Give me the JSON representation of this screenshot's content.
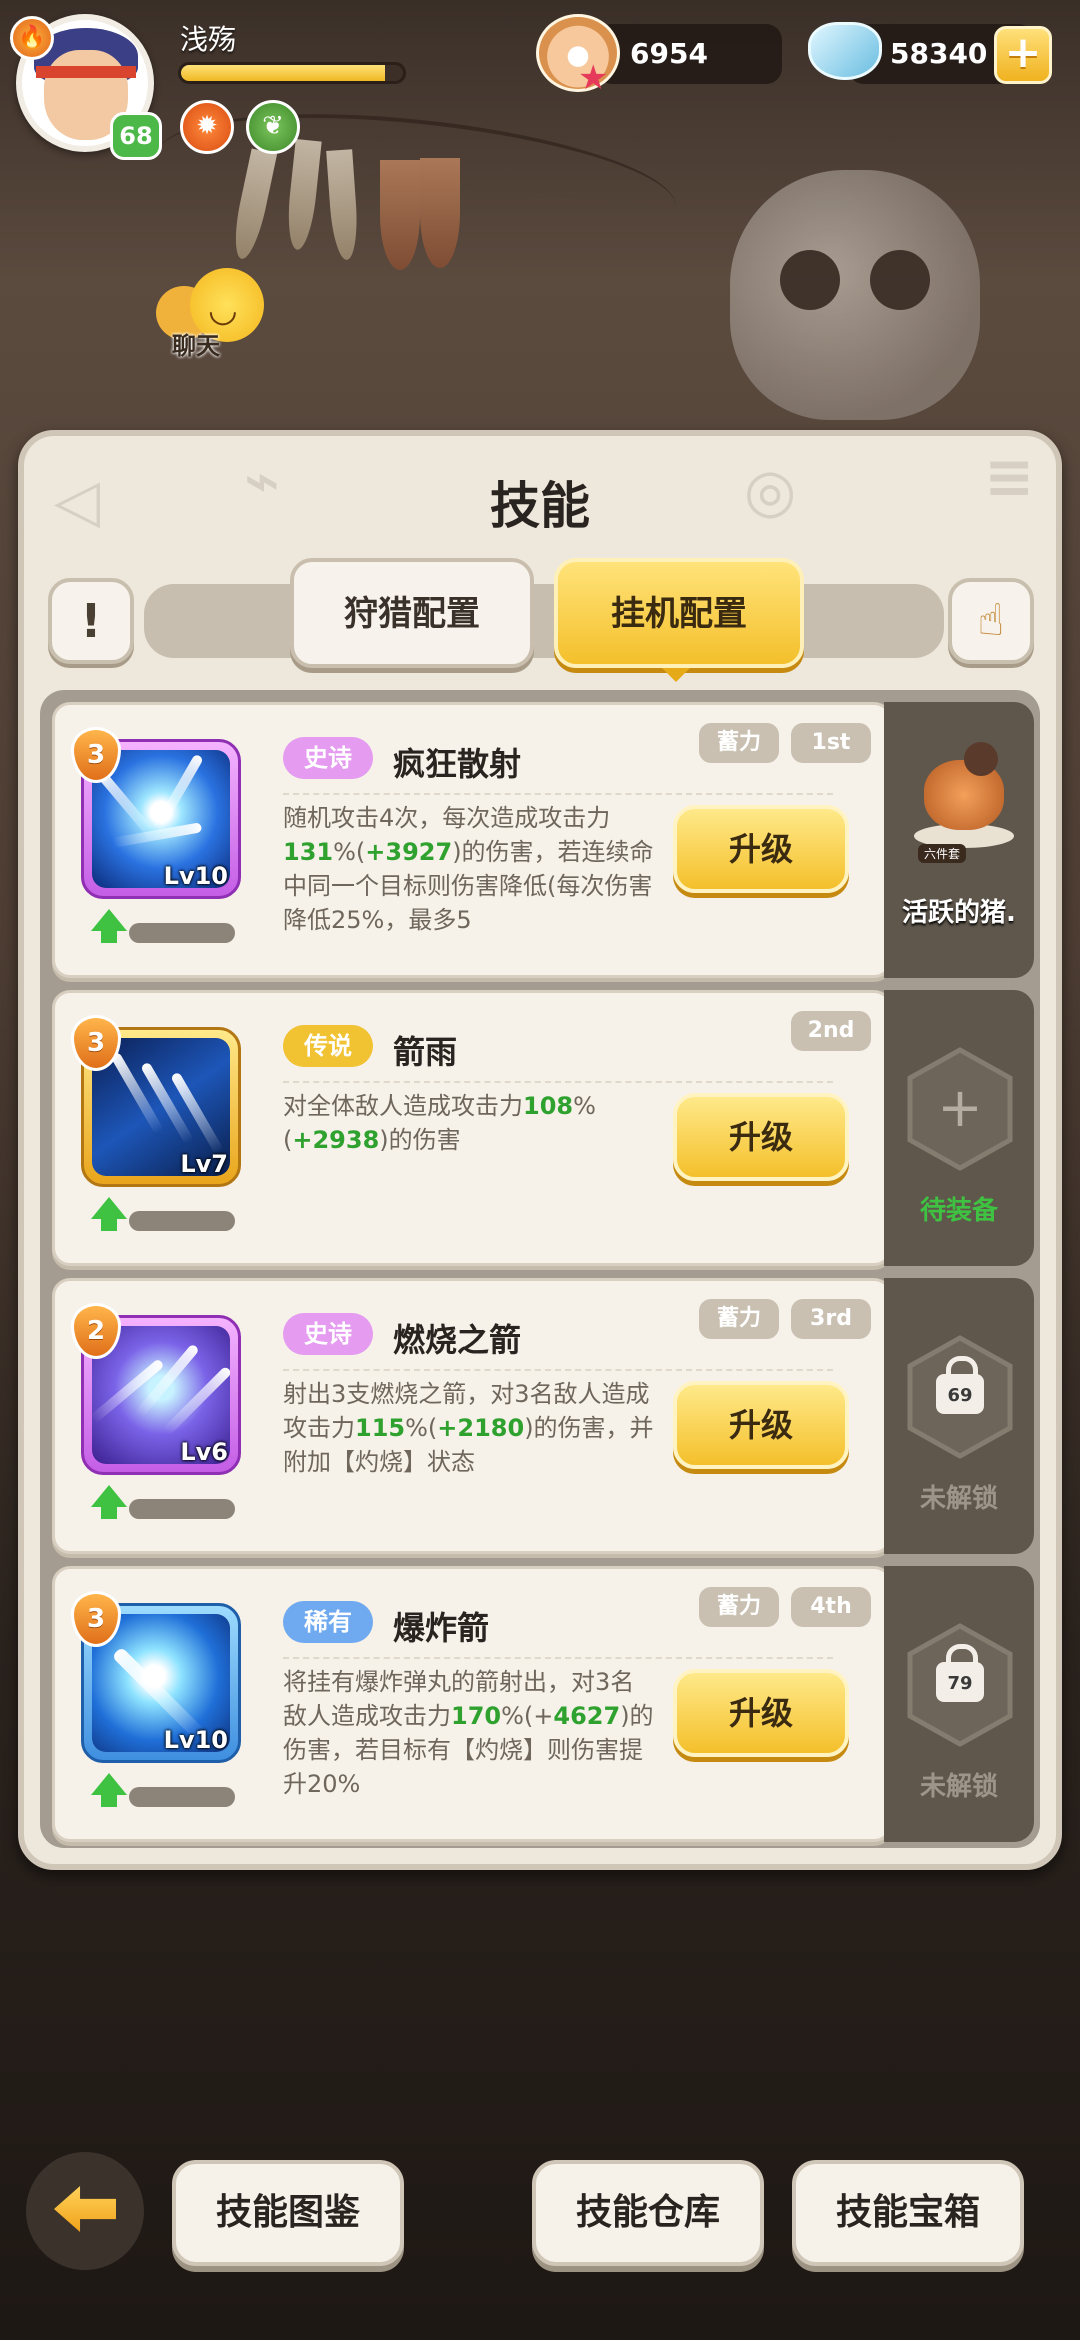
{
  "player": {
    "name": "浅殇",
    "level": "68",
    "exp_fraction": 0.92
  },
  "currency": {
    "pearls": "6954",
    "crystals": "58340"
  },
  "chat": {
    "label": "聊天"
  },
  "panel": {
    "title": "技能",
    "tabs": [
      {
        "label": "狩猎配置",
        "active": false
      },
      {
        "label": "挂机配置",
        "active": true
      }
    ]
  },
  "skills": [
    {
      "tier": "史诗",
      "tier_color": "#e49bf0",
      "name": "疯狂散射",
      "stars": "3",
      "level": "Lv10",
      "tags": [
        "蓄力",
        "1st"
      ],
      "desc": [
        {
          "t": "随机攻击4次，每次造成攻击力"
        },
        {
          "t": "131",
          "g": true
        },
        {
          "t": "%("
        },
        {
          "t": "+3927",
          "g": true
        },
        {
          "t": ")的伤害，若连续命中同一个目标则伤害降低(每次伤害降低25%，最多5"
        }
      ],
      "upgrade_label": "升级",
      "side": {
        "type": "pet",
        "set_label": "六件套",
        "label": "活跃的猪."
      }
    },
    {
      "tier": "传说",
      "tier_color": "#f1c232",
      "name": "箭雨",
      "stars": "3",
      "level": "Lv7",
      "tags": [
        "2nd"
      ],
      "desc": [
        {
          "t": "对全体敌人造成攻击力"
        },
        {
          "t": "108",
          "g": true
        },
        {
          "t": "%("
        },
        {
          "t": "+2938",
          "g": true
        },
        {
          "t": ")的伤害"
        }
      ],
      "upgrade_label": "升级",
      "side": {
        "type": "empty",
        "label": "待装备"
      }
    },
    {
      "tier": "史诗",
      "tier_color": "#e49bf0",
      "name": "燃烧之箭",
      "stars": "2",
      "level": "Lv6",
      "tags": [
        "蓄力",
        "3rd"
      ],
      "desc": [
        {
          "t": "射出3支燃烧之箭，对3名敌人造成攻击力"
        },
        {
          "t": "115",
          "g": true
        },
        {
          "t": "%("
        },
        {
          "t": "+2180",
          "g": true
        },
        {
          "t": ")的伤害，并附加【灼烧】状态"
        }
      ],
      "upgrade_label": "升级",
      "side": {
        "type": "locked",
        "unlock_level": "69",
        "label": "未解锁"
      }
    },
    {
      "tier": "稀有",
      "tier_color": "#6fa9ef",
      "name": "爆炸箭",
      "stars": "3",
      "level": "Lv10",
      "tags": [
        "蓄力",
        "4th"
      ],
      "desc": [
        {
          "t": "将挂有爆炸弹丸的箭射出，对3名敌人造成攻击力"
        },
        {
          "t": "170",
          "g": true
        },
        {
          "t": "%(+"
        },
        {
          "t": "4627",
          "g": true
        },
        {
          "t": ")的伤害，若目标有【灼烧】则伤害提升20%"
        }
      ],
      "upgrade_label": "升级",
      "side": {
        "type": "locked",
        "unlock_level": "79",
        "label": "未解锁"
      }
    }
  ],
  "bottom_bar": {
    "buttons": [
      "技能图鉴",
      "技能仓库",
      "技能宝箱"
    ]
  }
}
